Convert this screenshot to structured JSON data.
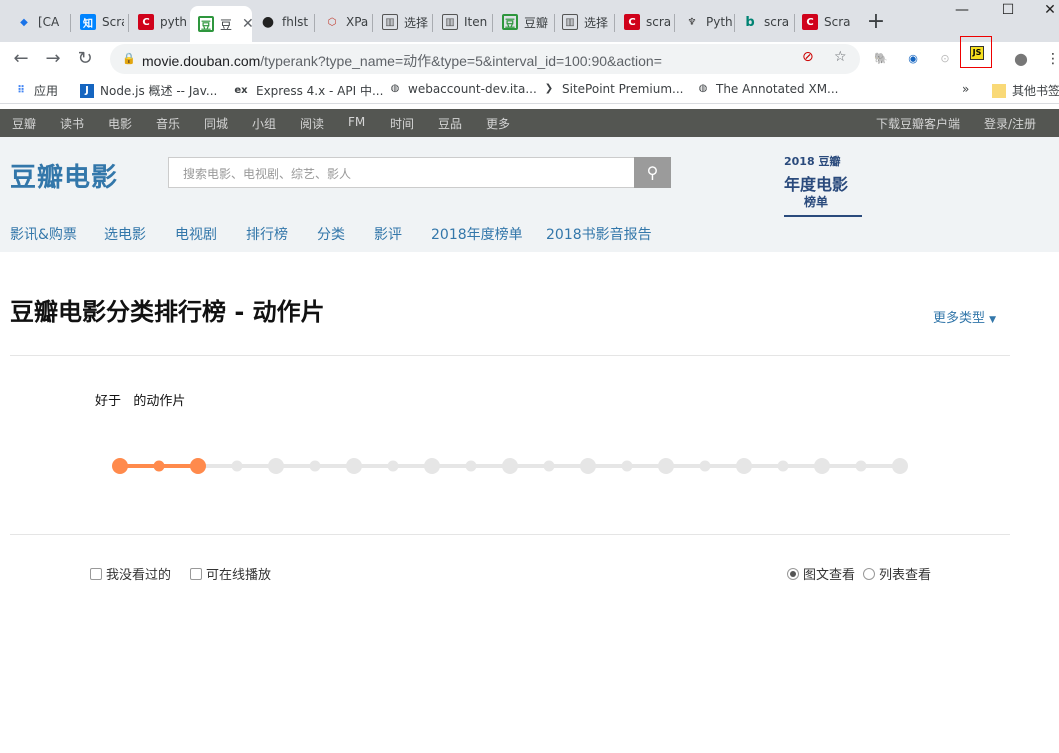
{
  "browser": {
    "tabs": [
      {
        "label": "[CA",
        "icon": "diamond-icon",
        "color": "#1a73e8"
      },
      {
        "label": "Scra",
        "icon": "zhihu-icon",
        "color": "#0084ff"
      },
      {
        "label": "pyth",
        "icon": "csdn-icon",
        "color": "#d0021b"
      },
      {
        "label": "豆",
        "icon": "douban-icon",
        "color": "#2e963d",
        "active": true
      },
      {
        "label": "fhlst",
        "icon": "github-icon",
        "color": "#222"
      },
      {
        "label": "XPa",
        "icon": "xpath-icon",
        "color": "#c0392b"
      },
      {
        "label": "选择",
        "icon": "page-icon",
        "color": "#555"
      },
      {
        "label": "Iten",
        "icon": "page-icon",
        "color": "#555"
      },
      {
        "label": "豆瓣",
        "icon": "douban-icon",
        "color": "#2e963d"
      },
      {
        "label": "选择",
        "icon": "page-icon",
        "color": "#555"
      },
      {
        "label": "scra",
        "icon": "csdn-icon",
        "color": "#d0021b"
      },
      {
        "label": "Pyth",
        "icon": "python-icon",
        "color": "#333"
      },
      {
        "label": "scra",
        "icon": "bing-icon",
        "color": "#008373"
      },
      {
        "label": "Scra",
        "icon": "csdn-icon",
        "color": "#d0021b"
      }
    ],
    "url_host": "movie.douban.com",
    "url_path": "/typerank?type_name=动作&type=5&interval_id=100:90&action=",
    "bookmarks": [
      {
        "label": "应用",
        "icon": "apps-icon"
      },
      {
        "label": "Node.js 概述 -- Jav...",
        "icon": "j-icon"
      },
      {
        "label": "Express 4.x - API 中...",
        "icon": "ex-icon"
      },
      {
        "label": "webaccount-dev.ita...",
        "icon": "globe-icon"
      },
      {
        "label": "SitePoint Premium...",
        "icon": "sitepoint-icon"
      },
      {
        "label": "The Annotated XM...",
        "icon": "globe-icon"
      },
      {
        "label": "»",
        "icon": ""
      },
      {
        "label": "其他书签",
        "icon": "folder-icon"
      }
    ]
  },
  "douban": {
    "top_nav": [
      "豆瓣",
      "读书",
      "电影",
      "音乐",
      "同城",
      "小组",
      "阅读",
      "FM",
      "时间",
      "豆品",
      "更多"
    ],
    "download": "下载豆瓣客户端",
    "login": "登录/注册",
    "logo": "豆瓣电影",
    "search_placeholder": "搜索电影、电视剧、综艺、影人",
    "sub_nav": [
      "影讯&购票",
      "选电影",
      "电视剧",
      "排行榜",
      "分类",
      "影评",
      "2018年度榜单",
      "2018书影音报告"
    ],
    "badge": {
      "year": "2018 豆瓣",
      "title": "年度电影",
      "sub": "榜单"
    }
  },
  "content": {
    "title": "豆瓣电影分类排行榜 - 动作片",
    "more_types": "更多类型",
    "good_prefix": "好于",
    "good_suffix": "的动作片",
    "slider": {
      "range_low_pct": 90,
      "range_high_pct": 100
    },
    "filters": {
      "not_watched": "我没看过的",
      "playable": "可在线播放"
    },
    "views": {
      "graphic": "图文查看",
      "list": "列表查看",
      "selected": "graphic"
    }
  },
  "colors": {
    "accent": "#3377aa",
    "slider": "#ff8a4c",
    "topbar": "#545652"
  }
}
